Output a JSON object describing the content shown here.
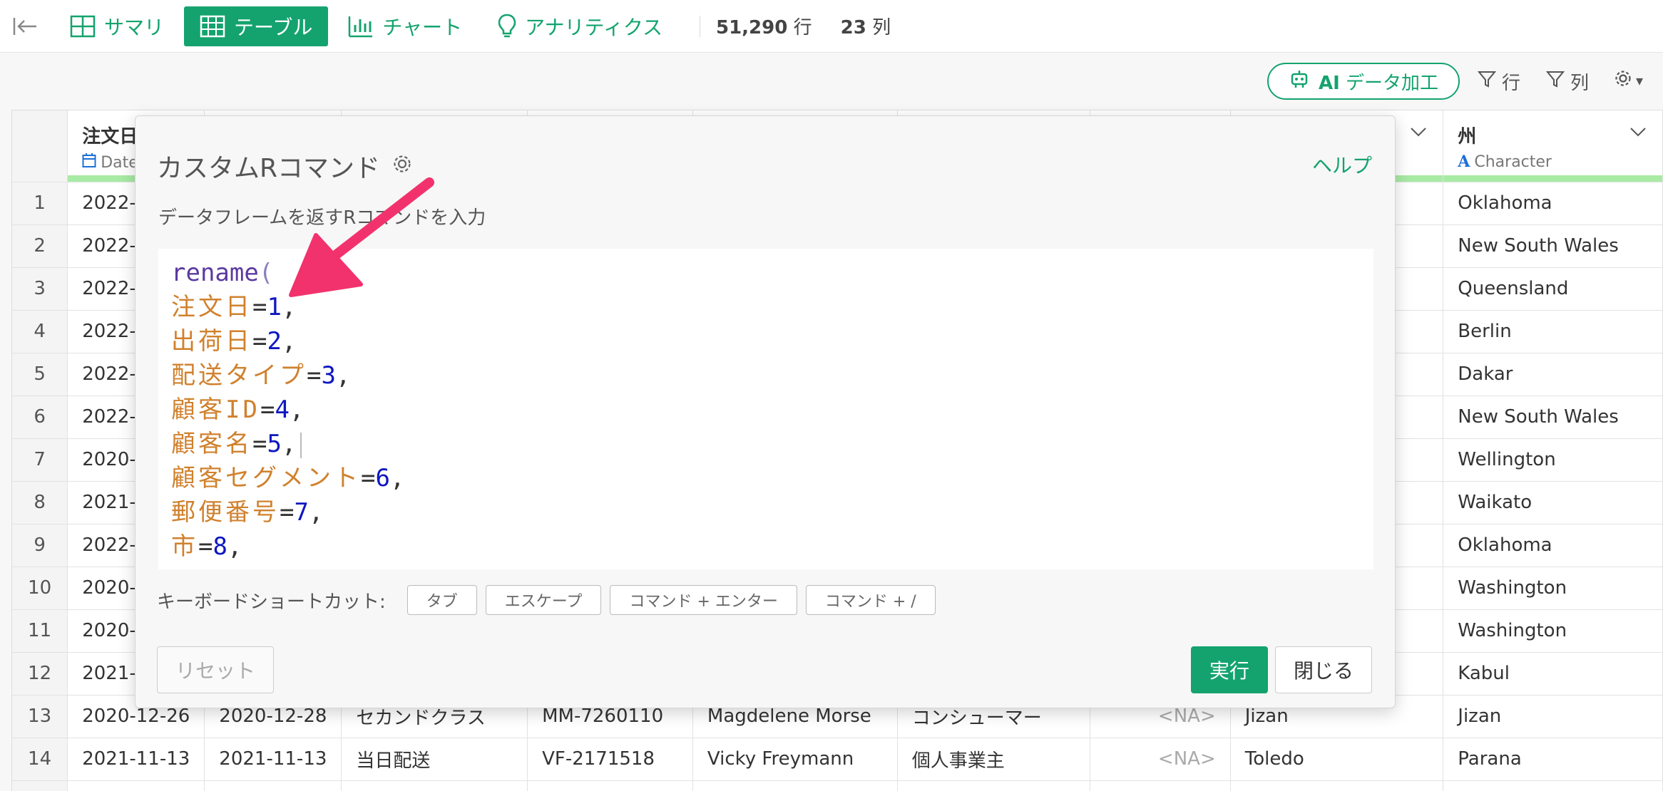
{
  "toolbar": {
    "tabs": [
      {
        "label": "サマリ",
        "icon": "grid-icon",
        "active": false
      },
      {
        "label": "テーブル",
        "icon": "table-icon",
        "active": true
      },
      {
        "label": "チャート",
        "icon": "bar-chart-icon",
        "active": false
      },
      {
        "label": "アナリティクス",
        "icon": "lightbulb-icon",
        "active": false
      }
    ],
    "rows_count": "51,290",
    "rows_unit": "行",
    "cols_count": "23",
    "cols_unit": "列"
  },
  "subbar": {
    "ai_prefix": "AI",
    "ai_label": "データ加工",
    "row_filter": "行",
    "col_filter": "列"
  },
  "table": {
    "columns": [
      {
        "name": "注文日",
        "type": "Date"
      },
      {
        "name": "",
        "type": ""
      },
      {
        "name": "",
        "type": ""
      },
      {
        "name": "",
        "type": ""
      },
      {
        "name": "",
        "type": ""
      },
      {
        "name": "",
        "type": ""
      },
      {
        "name": "",
        "type": ""
      },
      {
        "name": "",
        "type": ""
      },
      {
        "name": "州",
        "type": "Character"
      }
    ],
    "rows": [
      {
        "n": "1",
        "c1": "2022-",
        "c2": "",
        "c3": "",
        "c4": "",
        "c5": "",
        "c6": "",
        "c7": "",
        "c8": "",
        "c9": "Oklahoma"
      },
      {
        "n": "2",
        "c1": "2022-",
        "c2": "",
        "c3": "",
        "c4": "",
        "c5": "",
        "c6": "",
        "c7": "",
        "c8": "",
        "c9": "New South Wales"
      },
      {
        "n": "3",
        "c1": "2022-",
        "c2": "",
        "c3": "",
        "c4": "",
        "c5": "",
        "c6": "",
        "c7": "",
        "c8": "",
        "c9": "Queensland"
      },
      {
        "n": "4",
        "c1": "2022-",
        "c2": "",
        "c3": "",
        "c4": "",
        "c5": "",
        "c6": "",
        "c7": "",
        "c8": "",
        "c9": "Berlin"
      },
      {
        "n": "5",
        "c1": "2022-",
        "c2": "",
        "c3": "",
        "c4": "",
        "c5": "",
        "c6": "",
        "c7": "",
        "c8": "",
        "c9": "Dakar"
      },
      {
        "n": "6",
        "c1": "2022-",
        "c2": "",
        "c3": "",
        "c4": "",
        "c5": "",
        "c6": "",
        "c7": "",
        "c8": "",
        "c9": "New South Wales"
      },
      {
        "n": "7",
        "c1": "2020-",
        "c2": "",
        "c3": "",
        "c4": "",
        "c5": "",
        "c6": "",
        "c7": "",
        "c8": "",
        "c9": "Wellington"
      },
      {
        "n": "8",
        "c1": "2021-",
        "c2": "",
        "c3": "",
        "c4": "",
        "c5": "",
        "c6": "",
        "c7": "",
        "c8": "",
        "c9": "Waikato"
      },
      {
        "n": "9",
        "c1": "2022-",
        "c2": "",
        "c3": "",
        "c4": "",
        "c5": "",
        "c6": "",
        "c7": "",
        "c8": "",
        "c9": "Oklahoma"
      },
      {
        "n": "10",
        "c1": "2020-",
        "c2": "",
        "c3": "",
        "c4": "",
        "c5": "",
        "c6": "",
        "c7": "",
        "c8": "",
        "c9": "Washington"
      },
      {
        "n": "11",
        "c1": "2020-",
        "c2": "",
        "c3": "",
        "c4": "",
        "c5": "",
        "c6": "",
        "c7": "",
        "c8": "",
        "c9": "Washington"
      },
      {
        "n": "12",
        "c1": "2021-",
        "c2": "",
        "c3": "",
        "c4": "",
        "c5": "",
        "c6": "",
        "c7": "",
        "c8": "",
        "c9": "Kabul"
      },
      {
        "n": "13",
        "c1": "2020-12-26",
        "c2": "2020-12-28",
        "c3": "セカンドクラス",
        "c4": "MM-7260110",
        "c5": "Magdelene Morse",
        "c6": "コンシューマー",
        "c7": "<NA>",
        "c8": "Jizan",
        "c9": "Jizan"
      },
      {
        "n": "14",
        "c1": "2021-11-13",
        "c2": "2021-11-13",
        "c3": "当日配送",
        "c4": "VF-2171518",
        "c5": "Vicky Freymann",
        "c6": "個人事業主",
        "c7": "<NA>",
        "c8": "Toledo",
        "c9": "Parana"
      },
      {
        "n": "",
        "c1": "",
        "c2": "",
        "c3": "",
        "c4": "",
        "c5": "",
        "c6": "",
        "c7": "",
        "c8": "",
        "c9": ""
      }
    ]
  },
  "modal": {
    "title": "カスタムRコマンド",
    "help": "ヘルプ",
    "description": "データフレームを返すRコマンドを入力",
    "code_function": "rename",
    "code_lines": [
      {
        "name": "注文日",
        "value": "1"
      },
      {
        "name": "出荷日",
        "value": "2"
      },
      {
        "name": "配送タイプ",
        "value": "3"
      },
      {
        "name": "顧客ID",
        "value": "4"
      },
      {
        "name": "顧客名",
        "value": "5"
      },
      {
        "name": "顧客セグメント",
        "value": "6"
      },
      {
        "name": "郵便番号",
        "value": "7"
      },
      {
        "name": "市",
        "value": "8"
      }
    ],
    "shortcuts_label": "キーボードショートカット:",
    "shortcuts": [
      "タブ",
      "エスケープ",
      "コマンド + エンター",
      "コマンド + /"
    ],
    "reset": "リセット",
    "run": "実行",
    "close": "閉じる"
  },
  "colors": {
    "accent": "#14a36e",
    "annotation_arrow": "#f2326d",
    "type_bar": "#a8eba5"
  }
}
